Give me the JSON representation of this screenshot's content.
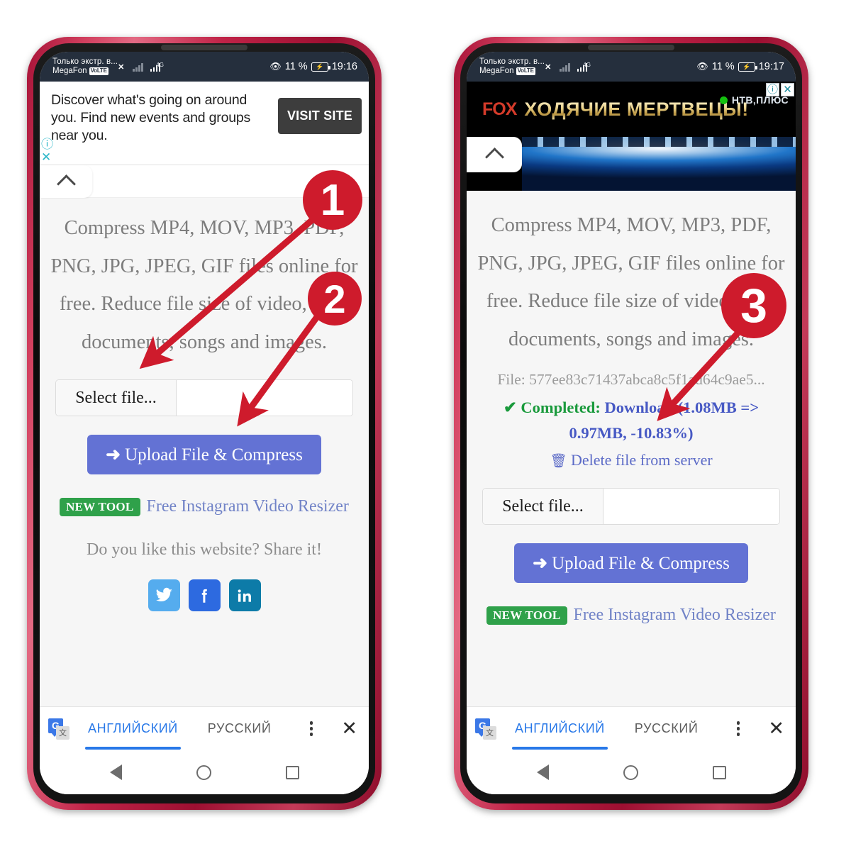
{
  "phones": [
    {
      "id": "left",
      "statusbar": {
        "carrier_line1": "Только экстр. в...",
        "carrier_line2": "MegaFon",
        "volte": "VoLTE",
        "net_label": "4G",
        "battery_percent": "11 %",
        "time": "19:16"
      },
      "ad": {
        "type": "text",
        "copy": "Discover what's going on around you. Find new events and groups near you.",
        "cta": "VISIT SITE",
        "info_icon": "ⓘ",
        "close_icon": "✕"
      }
    },
    {
      "id": "right",
      "statusbar": {
        "carrier_line1": "Только экстр. в...",
        "carrier_line2": "MegaFon",
        "volte": "VoLTE",
        "net_label": "4G",
        "battery_percent": "11 %",
        "time": "19:17"
      },
      "ad": {
        "type": "image",
        "brand": "FOX",
        "title": "ХОДЯЧИЕ МЕРТВЕЦЫ!",
        "channel": "НТВ‚ПЛЮС",
        "info_icon": "ⓘ",
        "close_icon": "✕"
      }
    }
  ],
  "site": {
    "hero": "Compress MP4, MOV, MP3, PDF, PNG, JPG, JPEG, GIF files online for free. Reduce file size of video, PDF documents, songs and images.",
    "select_file_label": "Select file...",
    "select_file_value": "",
    "upload_button": "Upload File & Compress",
    "upload_arrow": "➜",
    "newtool_badge": "NEW TOOL",
    "newtool_link": "Free Instagram Video Resizer",
    "share_text": "Do you like this website? Share it!",
    "social": [
      {
        "name": "twitter",
        "glyph": "twitter-icon"
      },
      {
        "name": "facebook",
        "glyph": "facebook-icon"
      },
      {
        "name": "linkedin",
        "glyph": "linkedin-icon"
      }
    ]
  },
  "result": {
    "file_label": "File: 577ee83c71437abca8c5f1ad64c9ae5...",
    "check_icon": "✔",
    "completed_label": "Completed:",
    "download_text": "Download (1.08MB => 0.97MB, -10.83%)",
    "delete_icon": "🗑",
    "delete_label": "Delete file from server"
  },
  "translate_bar": {
    "tab_active": "АНГЛИЙСКИЙ",
    "tab_inactive": "РУССКИЙ",
    "menu_icon": "overflow-menu-icon",
    "close_icon": "✕",
    "gt_source": "G",
    "gt_target": "文"
  },
  "markers": {
    "one": "1",
    "two": "2",
    "three": "3"
  },
  "colors": {
    "accent_blue": "#6372d4",
    "marker_red": "#ce1b2c",
    "success_green": "#1a9a3c",
    "link_blue": "#5c6bc7",
    "badge_green": "#2fa14a",
    "statusbar": "#252f3d",
    "frame": "#c02347"
  }
}
